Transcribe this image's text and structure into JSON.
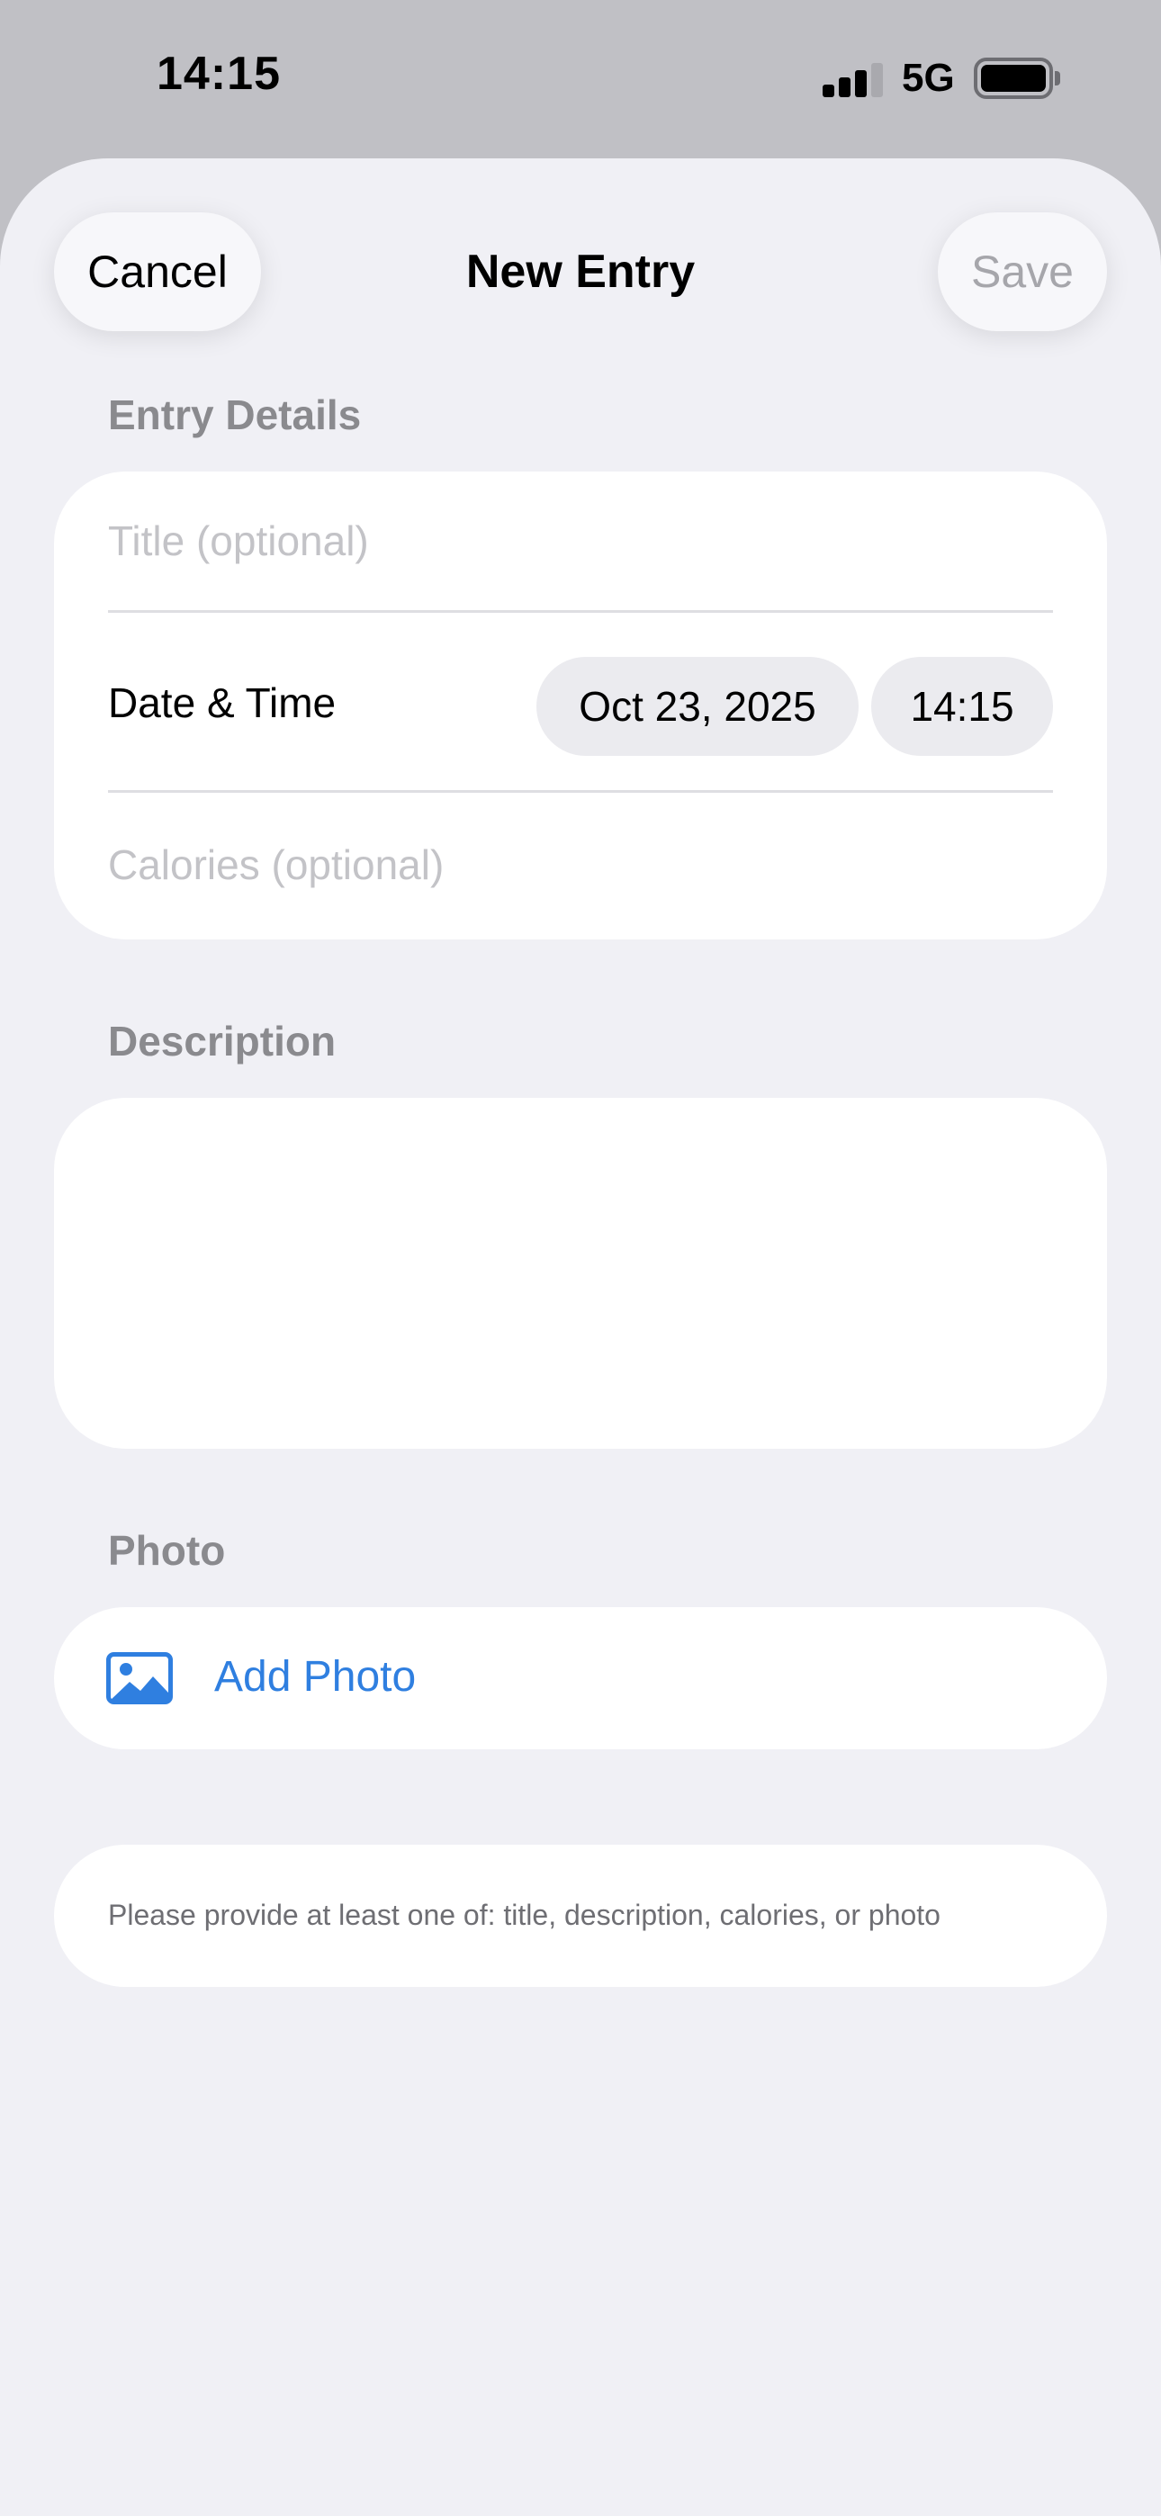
{
  "status_bar": {
    "time": "14:15",
    "network": "5G",
    "icons": [
      "signal-bars-icon",
      "battery-icon"
    ]
  },
  "nav": {
    "cancel_label": "Cancel",
    "title": "New Entry",
    "save_label": "Save"
  },
  "entry_details": {
    "section_label": "Entry Details",
    "title_placeholder": "Title (optional)",
    "date_time_label": "Date & Time",
    "date_value": "Oct 23, 2025",
    "time_value": "14:15",
    "calories_placeholder": "Calories (optional)"
  },
  "description": {
    "section_label": "Description",
    "value": ""
  },
  "photo": {
    "section_label": "Photo",
    "add_label": "Add Photo",
    "icon": "photo-icon"
  },
  "hint": {
    "text": "Please provide at least one of: title, description, calories, or photo"
  },
  "colors": {
    "accent": "#2f7fe0",
    "background": "#f0f0f5",
    "card": "#ffffff",
    "disabled": "#a6a6ab"
  }
}
